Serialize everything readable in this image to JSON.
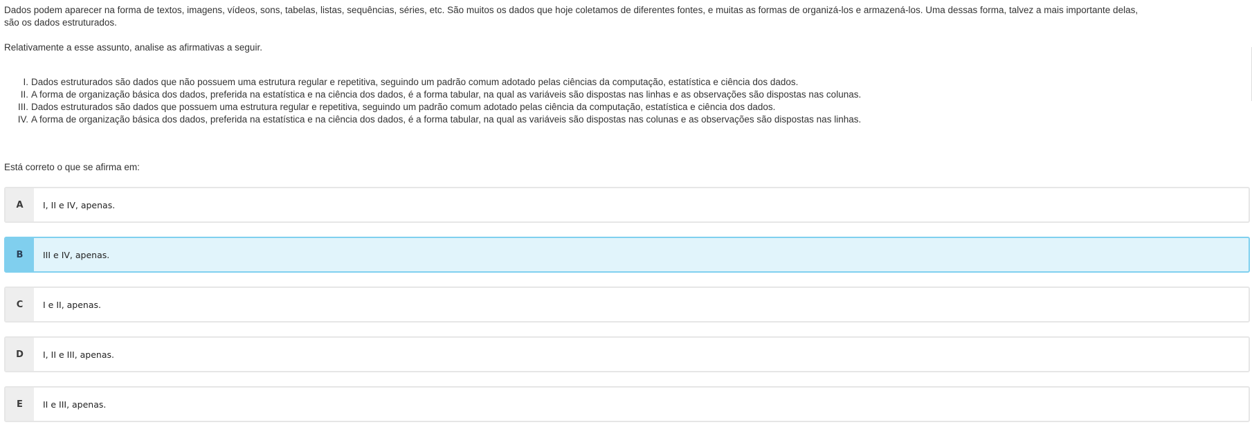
{
  "question": {
    "intro_line1": "Dados podem aparecer na forma de textos, imagens, vídeos, sons, tabelas, listas, sequências, séries, etc. São muitos os dados que hoje coletamos de diferentes fontes, e muitas as formas de organizá-los e armazená-los. Uma dessas forma, talvez a mais importante delas,",
    "intro_line2": "são os dados estruturados.",
    "lead": "Relativamente a esse assunto, analise as afirmativas a seguir.",
    "statements": [
      {
        "num": "I.",
        "text": "Dados estruturados são dados que não possuem uma estrutura regular e repetitiva, seguindo um padrão comum adotado pelas ciências da computação, estatística e ciência dos dados."
      },
      {
        "num": "II.",
        "text": "A forma de organização básica dos dados, preferida na estatística e na ciência dos dados, é a forma tabular, na qual as variáveis são dispostas nas linhas e as observações são dispostas nas colunas."
      },
      {
        "num": "III.",
        "text": "Dados estruturados são dados que possuem uma estrutura regular e repetitiva, seguindo um padrão comum adotado pelas ciência da computação, estatística e ciência dos dados."
      },
      {
        "num": "IV.",
        "text": "A forma de organização básica dos dados, preferida na estatística e na ciência dos dados, é a forma tabular, na qual as variáveis são dispostas nas colunas e as observações são dispostas nas linhas."
      }
    ],
    "prompt": "Está correto o que se afirma em:"
  },
  "options": [
    {
      "letter": "A",
      "text": "I, II e IV, apenas."
    },
    {
      "letter": "B",
      "text": "III e IV, apenas."
    },
    {
      "letter": "C",
      "text": "I e II, apenas."
    },
    {
      "letter": "D",
      "text": "I, II e III, apenas."
    },
    {
      "letter": "E",
      "text": "II e III,  apenas."
    }
  ],
  "selected_option": "B",
  "colors": {
    "selected_border": "#7fd0ef",
    "selected_background": "#e1f4fb",
    "selected_letter_background": "#80cfee",
    "letter_background": "#eeeeee",
    "option_border": "#e6e6e6"
  }
}
